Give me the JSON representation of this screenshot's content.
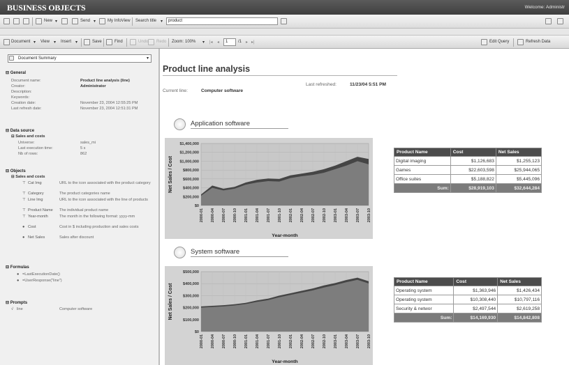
{
  "app": {
    "brand": "BUSINESS OBJECTS",
    "welcome": "Welcome: Administr"
  },
  "toolbar1": {
    "new_label": "New",
    "send_label": "Send",
    "myinfoview_label": "My InfoView",
    "search_title_label": "Search title",
    "search_value": "product"
  },
  "toolbar2": {
    "document_label": "Document",
    "view_label": "View",
    "insert_label": "Insert",
    "save_label": "Save",
    "find_label": "Find",
    "undo_label": "Undo",
    "redo_label": "Redo",
    "zoom_label": "Zoom:",
    "zoom_value": "100%",
    "page_value": "1",
    "page_total": "/1",
    "edit_query_label": "Edit Query",
    "refresh_label": "Refresh Data"
  },
  "left": {
    "panel_select": "Document Summary",
    "general": {
      "header": "General",
      "rows": [
        {
          "label": "Document name:",
          "value": "Product line analysis (line)",
          "bold": true
        },
        {
          "label": "Creator:",
          "value": "Administrator",
          "bold": true
        },
        {
          "label": "Description:",
          "value": ""
        },
        {
          "label": "Keywords:",
          "value": ""
        },
        {
          "label": "Creation date:",
          "value": "November 23, 2004 12:55:25 PM"
        },
        {
          "label": "Last refresh date:",
          "value": "November 23, 2004 12:51:31 PM"
        }
      ]
    },
    "data_source": {
      "header": "Data source",
      "sub": "Sales and costs",
      "rows": [
        {
          "label": "Universe:",
          "value": "sales_mi"
        },
        {
          "label": "Last execution time:",
          "value": "5 s"
        },
        {
          "label": "Nb of rows:",
          "value": "862"
        }
      ]
    },
    "objects": {
      "header": "Objects",
      "sub": "Sales and costs",
      "items": [
        {
          "name": "Cat Img",
          "desc": "URL to the icon associated with the product category"
        },
        {
          "name": "Category",
          "desc": "The product categories name"
        },
        {
          "name": "Line Img",
          "desc": "URL to the icon associated with the line of products"
        },
        {
          "name": "Product Name",
          "desc": "The individual product name"
        },
        {
          "name": "Year-month",
          "desc": "The month in the following format: yyyy-mm"
        },
        {
          "name": "Cost",
          "desc": "Cost in $ including production and sales costs"
        },
        {
          "name": "Net Sales",
          "desc": "Sales after discount"
        }
      ]
    },
    "formulas": {
      "header": "Formulas",
      "items": [
        "=LastExecutionDate()",
        "=UserResponse(\"line\")"
      ]
    },
    "prompts": {
      "header": "Prompts",
      "items": [
        {
          "name": "line",
          "value": "Computer software"
        }
      ]
    }
  },
  "report": {
    "title": "Product line analysis",
    "last_refreshed_label": "Last refreshed:",
    "last_refreshed_value": "11/23/04 5:51 PM",
    "current_line_label": "Current line:",
    "current_line_value": "Computer software",
    "sections": [
      {
        "title": "Application software",
        "table": {
          "headers": [
            "Product Name",
            "Cost",
            "Net Sales"
          ],
          "rows": [
            [
              "Digital imaging",
              "$1,126,683",
              "$1,255,123"
            ],
            [
              "Games",
              "$22,603,598",
              "$25,944,065"
            ],
            [
              "Office suites",
              "$5,188,822",
              "$5,445,096"
            ]
          ],
          "sum": [
            "Sum:",
            "$28,919,103",
            "$32,644,284"
          ]
        }
      },
      {
        "title": "System software",
        "table": {
          "headers": [
            "Product Name",
            "Cost",
            "Net Sales"
          ],
          "rows": [
            [
              "Operating system",
              "$1,363,946",
              "$1,426,434"
            ],
            [
              "Operating system",
              "$10,308,440",
              "$10,797,116"
            ],
            [
              "Security & networ",
              "$2,497,544",
              "$2,619,258"
            ]
          ],
          "sum": [
            "Sum:",
            "$14,169,930",
            "$14,842,808"
          ]
        }
      }
    ]
  },
  "colors": {
    "cost_fill": "#7d7d7d",
    "sales_fill": "#454545",
    "plot_bg": "#d3d3d3"
  },
  "chart_data": [
    {
      "type": "area",
      "title": "",
      "xlabel": "Year-month",
      "ylabel": "Net Sales / Cost",
      "x": [
        "2000-01",
        "2000-04",
        "2000-07",
        "2000-10",
        "2001-01",
        "2001-04",
        "2001-07",
        "2001-10",
        "2002-01",
        "2002-04",
        "2002-07",
        "2002-10",
        "2003-01",
        "2003-04",
        "2003-07",
        "2003-10"
      ],
      "ylim": [
        0,
        1400000
      ],
      "yticks": [
        "$1,400,000",
        "$1,200,000",
        "$1,000,000",
        "$800,000",
        "$600,000",
        "$400,000",
        "$200,000",
        "$0"
      ],
      "series": [
        {
          "name": "",
          "values": [
            250000,
            450000,
            380000,
            420000,
            520000,
            580000,
            610000,
            600000,
            680000,
            720000,
            760000,
            820000,
            900000,
            1000000,
            1100000,
            1050000
          ]
        },
        {
          "name": "",
          "values": [
            220000,
            400000,
            340000,
            380000,
            470000,
            520000,
            550000,
            540000,
            620000,
            660000,
            690000,
            740000,
            820000,
            900000,
            1000000,
            930000
          ]
        }
      ]
    },
    {
      "type": "area",
      "title": "",
      "xlabel": "Year-month",
      "ylabel": "Net Sales / Cost",
      "x": [
        "2000-01",
        "2000-04",
        "2000-07",
        "2000-10",
        "2001-01",
        "2001-04",
        "2001-07",
        "2001-10",
        "2002-01",
        "2002-04",
        "2002-07",
        "2002-10",
        "2003-01",
        "2003-04",
        "2003-07",
        "2003-10"
      ],
      "ylim": [
        0,
        500000
      ],
      "yticks": [
        "$500,000",
        "$400,000",
        "$300,000",
        "$200,000",
        "$100,000",
        "$0"
      ],
      "series": [
        {
          "name": "",
          "values": [
            210000,
            215000,
            220000,
            228000,
            240000,
            260000,
            275000,
            300000,
            320000,
            340000,
            360000,
            385000,
            405000,
            430000,
            450000,
            420000
          ]
        },
        {
          "name": "",
          "values": [
            200000,
            205000,
            210000,
            218000,
            230000,
            248000,
            262000,
            286000,
            306000,
            325000,
            344000,
            368000,
            388000,
            412000,
            432000,
            402000
          ]
        }
      ]
    }
  ]
}
